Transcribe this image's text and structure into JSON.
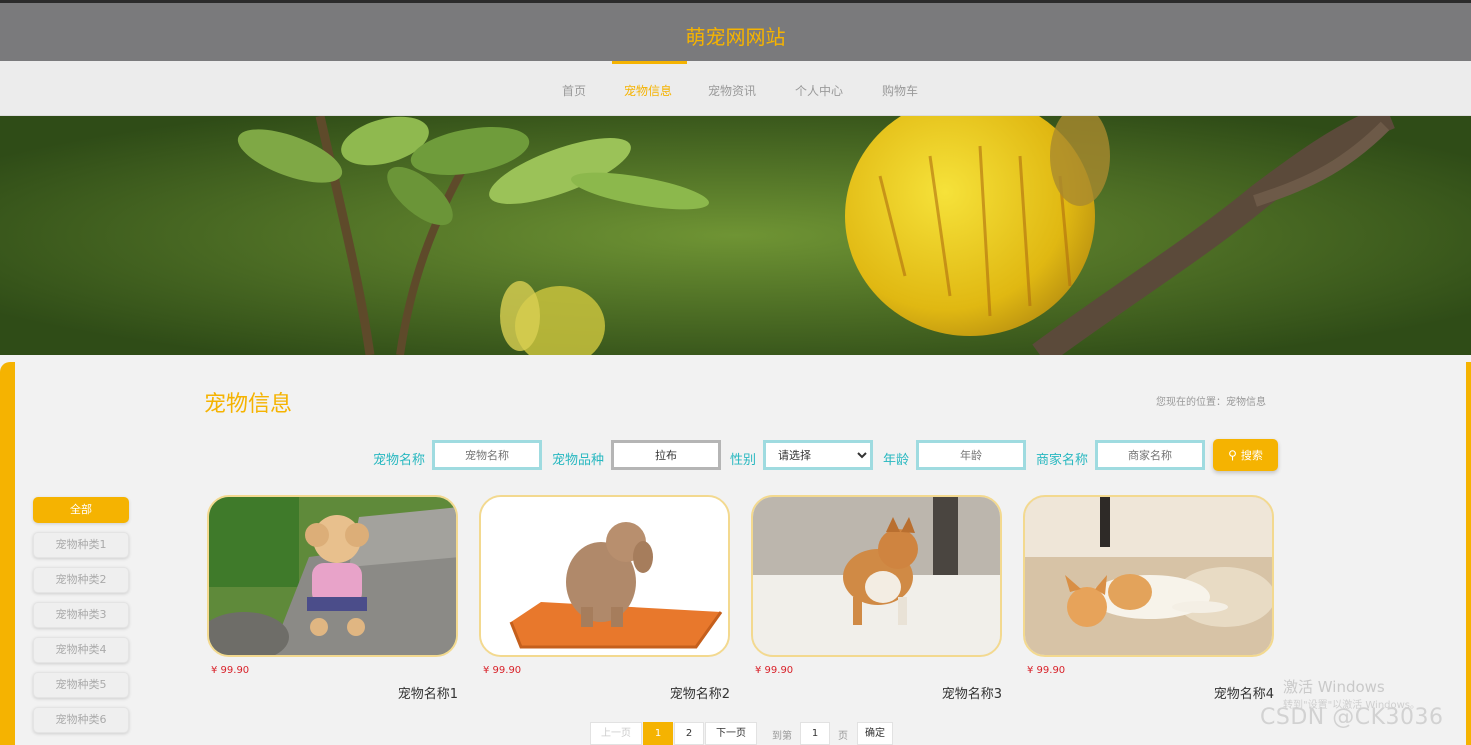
{
  "site": {
    "title": "萌宠网网站"
  },
  "nav": {
    "items": [
      {
        "label": "首页",
        "active": false
      },
      {
        "label": "宠物信息",
        "active": true
      },
      {
        "label": "宠物资讯",
        "active": false
      },
      {
        "label": "个人中心",
        "active": false
      },
      {
        "label": "购物车",
        "active": false
      }
    ]
  },
  "banner": {
    "slides": 3,
    "active_slide": 2
  },
  "page": {
    "title": "宠物信息",
    "breadcrumb_prefix": "您现在的位置：",
    "breadcrumb_current": "宠物信息"
  },
  "search": {
    "fields": [
      {
        "label": "宠物名称",
        "placeholder": "宠物名称",
        "value": ""
      },
      {
        "label": "宠物品种",
        "placeholder": "宠物品种",
        "value": "拉布"
      },
      {
        "label": "性别",
        "select_value": "请选择"
      },
      {
        "label": "年龄",
        "placeholder": "年龄",
        "value": ""
      },
      {
        "label": "商家名称",
        "placeholder": "商家名称",
        "value": ""
      }
    ],
    "button_label": "搜索",
    "button_icon": "search-icon"
  },
  "categories": [
    "全部",
    "宠物种类1",
    "宠物种类2",
    "宠物种类3",
    "宠物种类4",
    "宠物种类5",
    "宠物种类6"
  ],
  "products": [
    {
      "price": "¥ 99.90",
      "name": "宠物名称1",
      "image": "poodle-on-rocks"
    },
    {
      "price": "¥ 99.90",
      "name": "宠物名称2",
      "image": "poodle-on-cushion"
    },
    {
      "price": "¥ 99.90",
      "name": "宠物名称3",
      "image": "shiba-on-rug"
    },
    {
      "price": "¥ 99.90",
      "name": "宠物名称4",
      "image": "kitten-lying"
    }
  ],
  "pagination": {
    "prev": "上一页",
    "pages": [
      "1",
      "2"
    ],
    "current": "1",
    "next": "下一页",
    "goto_label": "到第",
    "goto_value": "1",
    "page_unit": "页",
    "confirm": "确定"
  },
  "overlay": {
    "activate_title": "激活 Windows",
    "activate_sub": "转到\"设置\"以激活 Windows。",
    "csdn": "CSDN @CK3036"
  },
  "colors": {
    "accent": "#f5b301",
    "label": "#28b8c0",
    "price": "#d9232b",
    "header": "#7a7a7c"
  }
}
